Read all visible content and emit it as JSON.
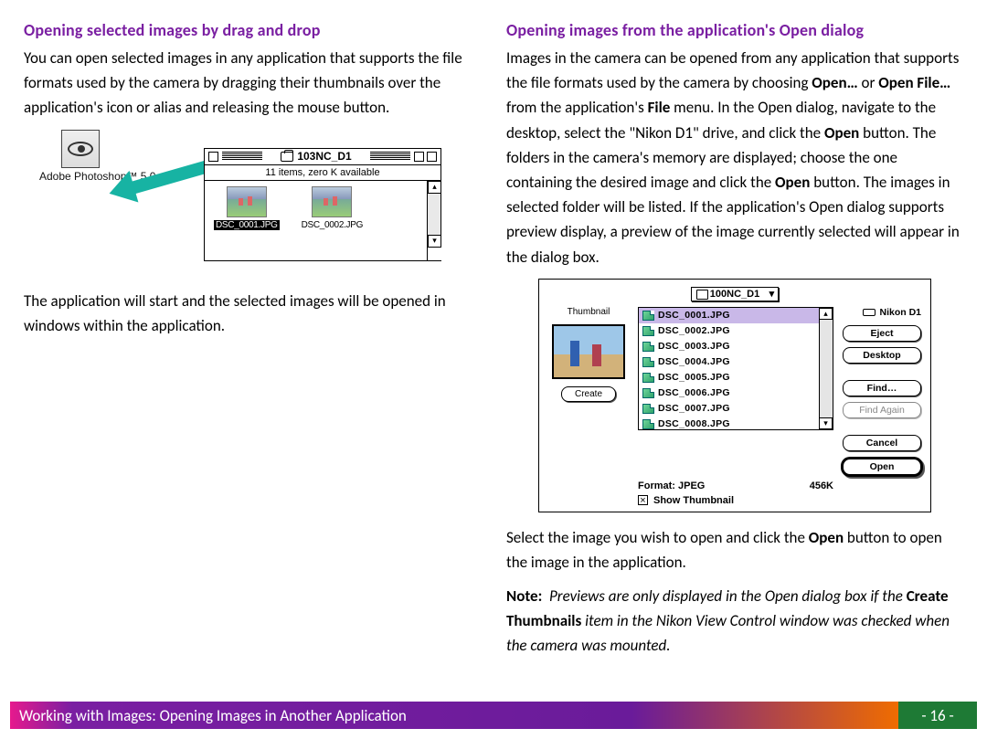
{
  "left": {
    "heading": "Opening selected images by drag and drop",
    "p1": "You can open selected images in any application that supports the file formats used by the camera by dragging their thumbnails over the application's icon or alias and releasing the mouse button.",
    "fig": {
      "app_label": "Adobe Photoshop™ 5.0",
      "window_title": "103NC_D1",
      "status": "11 items, zero K available",
      "file1": "DSC_0001.JPG",
      "file2": "DSC_0002.JPG"
    },
    "p2": "The application will start and the selected images will be opened in windows within the application."
  },
  "right": {
    "heading": "Opening images from the application's Open dialog",
    "p1a": "Images in the camera can be opened from any application that supports the file formats used by the camera by choosing ",
    "p1_openellipsis": "Open…",
    "p1_or": " or ",
    "p1_openfile": "Open File…",
    "p1_fromthe": " from the application's ",
    "p1_file": "File",
    "p1b": " menu.  In the Open dialog, navigate to the desktop, select the \"Nikon D1\" drive, and click the ",
    "p1_open1": "Open",
    "p1c": " button.  The folders in the camera's memory are displayed; choose the one containing the desired image and click the ",
    "p1_open2": "Open",
    "p1d": " button.  The images in selected folder will be listed.  If the application's Open dialog supports preview display, a preview of the image currently selected will appear in the dialog box.",
    "dlg": {
      "folder": "100NC_D1",
      "drive": "Nikon D1",
      "thumbnail_label": "Thumbnail",
      "create_btn": "Create",
      "files": [
        "DSC_0001.JPG",
        "DSC_0002.JPG",
        "DSC_0003.JPG",
        "DSC_0004.JPG",
        "DSC_0005.JPG",
        "DSC_0006.JPG",
        "DSC_0007.JPG",
        "DSC_0008.JPG"
      ],
      "eject": "Eject",
      "desktop": "Desktop",
      "find": "Find…",
      "find_again": "Find Again",
      "cancel": "Cancel",
      "open": "Open",
      "format_label": "Format:  JPEG",
      "size": "456K",
      "show_thumb": "Show Thumbnail"
    },
    "p2a": "Select the image you wish to open and click the ",
    "p2_open": "Open",
    "p2b": " button to open the image in the application.",
    "note_label": "Note:",
    "note_i1": "Previews are only displayed in the Open dialog box if the ",
    "note_bold": "Create Thumbnails",
    "note_i2": " item in the Nikon View Control window was checked when the camera was mounted."
  },
  "footer": {
    "text": "Working with Images:  Opening Images in Another Application",
    "page": "- 16 -"
  }
}
